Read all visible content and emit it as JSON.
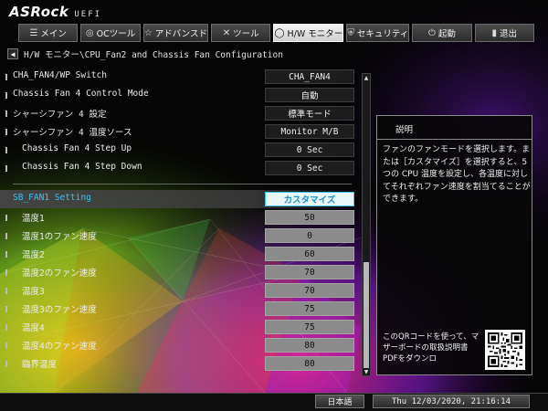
{
  "header": {
    "brand": "ASRock",
    "uefi": "UEFI"
  },
  "tabs": [
    {
      "icon": "☰",
      "label": "メイン"
    },
    {
      "icon": "◎",
      "label": "OCツール"
    },
    {
      "icon": "☆",
      "label": "アドバンスド"
    },
    {
      "icon": "✕",
      "label": "ツール"
    },
    {
      "icon": "◯",
      "label": "H/W モニター",
      "active": true
    },
    {
      "icon": "⛨",
      "label": "セキュリティ"
    },
    {
      "icon": "⏻",
      "label": "起動"
    },
    {
      "icon": "▮",
      "label": "退出"
    }
  ],
  "breadcrumb": "H/W モニター\\CPU_Fan2 and Chassis Fan Configuration",
  "settings": [
    {
      "label": "CHA_FAN4/WP Switch",
      "value": "CHA_FAN4"
    },
    {
      "label": "Chassis Fan 4 Control Mode",
      "value": "自動"
    },
    {
      "label": "シャーシファン 4 設定",
      "value": "標準モード"
    },
    {
      "label": "シャーシファン 4 温度ソース",
      "value": "Monitor M/B"
    },
    {
      "label": "Chassis Fan 4 Step Up",
      "value": "0 Sec"
    },
    {
      "label": "Chassis Fan 4 Step Down",
      "value": "0 Sec"
    },
    {
      "label": "SB_FAN1 Setting",
      "value": "カスタマイズ"
    },
    {
      "label": "温度1",
      "value": "50"
    },
    {
      "label": "温度1のファン速度",
      "value": "0"
    },
    {
      "label": "温度2",
      "value": "60"
    },
    {
      "label": "温度2のファン速度",
      "value": "70"
    },
    {
      "label": "温度3",
      "value": "70"
    },
    {
      "label": "温度3のファン速度",
      "value": "75"
    },
    {
      "label": "温度4",
      "value": "75"
    },
    {
      "label": "温度4のファン速度",
      "value": "80"
    },
    {
      "label": "臨界温度",
      "value": "80"
    }
  ],
  "description": {
    "title": "説明",
    "text": "ファンのファンモードを選択します。または［カスタマイズ］を選択すると、5 つの CPU 温度を設定し、各温度に対してそれぞれファン速度を割当てることができます。",
    "qr_text": "このQRコードを使って、マザーボードの取扱説明書PDFをダウンロ"
  },
  "footer": {
    "language": "日本語",
    "datetime": "Thu 12/03/2020, 21:16:14"
  },
  "colors": {
    "accent": "#39c4ef"
  },
  "icons": {
    "back": "back-arrow-icon",
    "scroll_up": "scroll-up-icon",
    "scroll_down": "scroll-down-icon",
    "qr": "qr-code-icon"
  }
}
